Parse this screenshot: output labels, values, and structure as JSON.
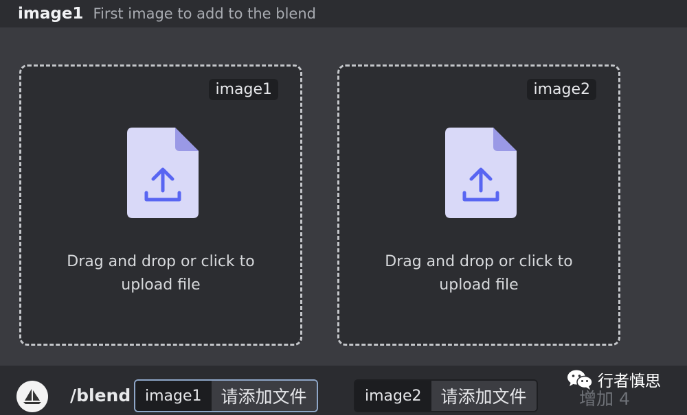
{
  "header": {
    "param_name": "image1",
    "param_description": "First image to add to the blend"
  },
  "dropzones": [
    {
      "badge": "image1",
      "text": "Drag and drop or click to\nupload file",
      "icon": "upload-file-icon"
    },
    {
      "badge": "image2",
      "text": "Drag and drop or click to\nupload file",
      "icon": "upload-file-icon"
    }
  ],
  "command_bar": {
    "command": "/blend",
    "options": [
      {
        "name": "image1",
        "value": "请添加文件",
        "active": true
      },
      {
        "name": "image2",
        "value": "请添加文件",
        "active": false
      }
    ],
    "increase": "增加 4"
  },
  "watermark": {
    "text": "行者慎思",
    "icon": "wechat-icon"
  },
  "colors": {
    "background": "#3a3b40",
    "dropzone": "#2c2d31",
    "file_icon": "#d9d9f8",
    "file_fold": "#9a99e6",
    "upload_arrow": "#5865f2",
    "active_chip_border": "#8fa7c8"
  }
}
